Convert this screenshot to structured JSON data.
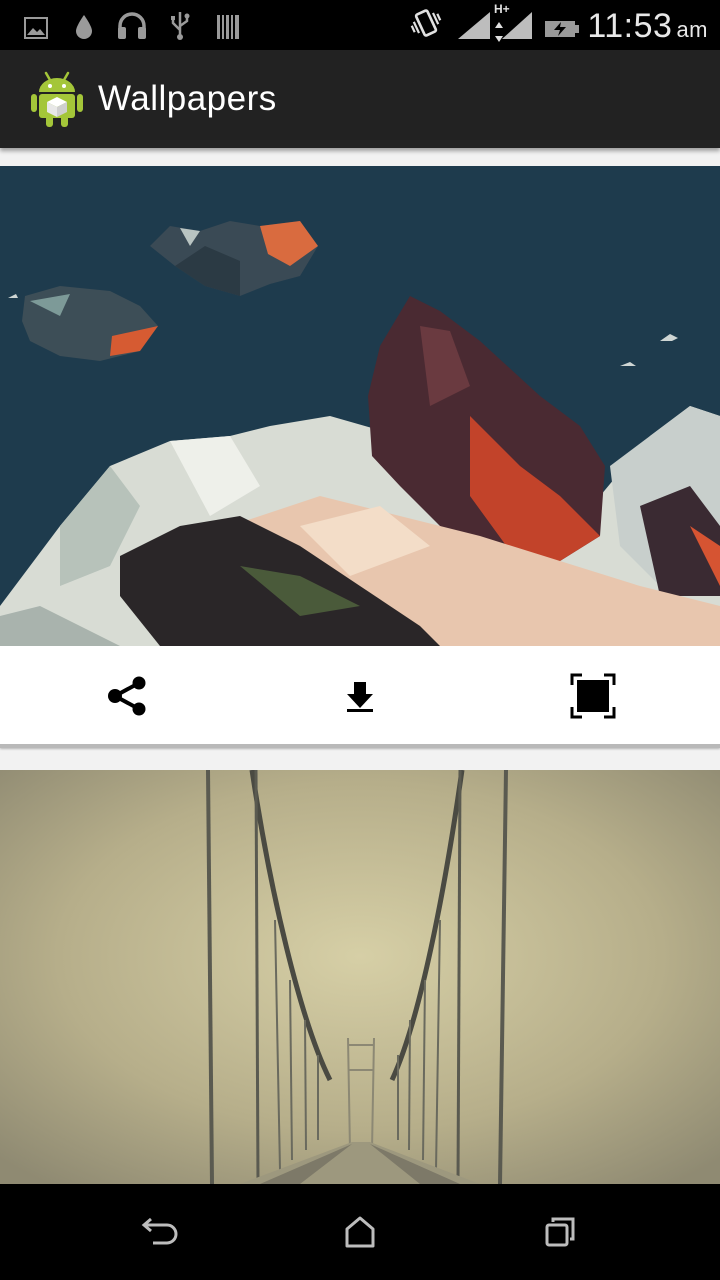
{
  "status_bar": {
    "time": "11:53",
    "ampm": "am",
    "network_type": "H+",
    "icons": [
      "gallery-icon",
      "water-drop-icon",
      "headphones-icon",
      "usb-icon",
      "barcode-icon",
      "vibrate-icon",
      "signal-icon",
      "signal-icon",
      "battery-charging-icon"
    ]
  },
  "action_bar": {
    "title": "Wallpapers",
    "logo": "android-logo"
  },
  "wallpapers": [
    {
      "subject": "low poly mountains",
      "actions": [
        "share-icon",
        "download-icon",
        "set-wallpaper-icon"
      ]
    },
    {
      "subject": "foggy suspension bridge"
    }
  ],
  "nav_bar": {
    "buttons": [
      "back-icon",
      "home-icon",
      "recents-icon"
    ]
  },
  "colors": {
    "status_bar": "#000000",
    "action_bar": "#222222",
    "background": "#f2f2f2",
    "android_green": "#a4c639"
  }
}
